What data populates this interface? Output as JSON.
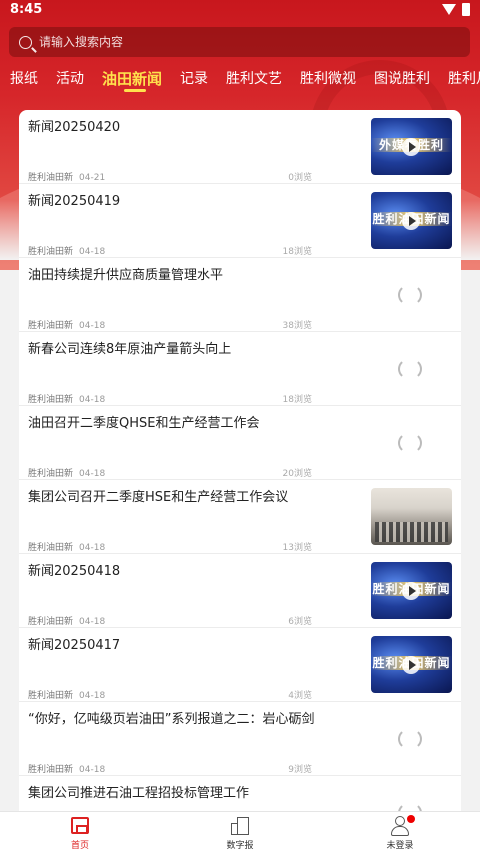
{
  "status_bar": {
    "time": "8:45"
  },
  "search": {
    "placeholder": "请输入搜索内容"
  },
  "tabs": [
    {
      "label": "报纸",
      "active": false
    },
    {
      "label": "活动",
      "active": false
    },
    {
      "label": "油田新闻",
      "active": true
    },
    {
      "label": "记录",
      "active": false
    },
    {
      "label": "胜利文艺",
      "active": false
    },
    {
      "label": "胜利微视",
      "active": false
    },
    {
      "label": "图说胜利",
      "active": false
    },
    {
      "label": "胜利月刊",
      "active": false
    }
  ],
  "articles": [
    {
      "title": "新闻20250420",
      "source": "胜利油田新",
      "date": "04-21",
      "views": "0浏览",
      "thumb": "video",
      "thumb_text": "外媒看胜利"
    },
    {
      "title": "新闻20250419",
      "source": "胜利油田新",
      "date": "04-18",
      "views": "18浏览",
      "thumb": "video",
      "thumb_text": "胜利油田新闻"
    },
    {
      "title": "油田持续提升供应商质量管理水平",
      "source": "胜利油田新",
      "date": "04-18",
      "views": "38浏览",
      "thumb": "loading"
    },
    {
      "title": "新春公司连续8年原油产量箭头向上",
      "source": "胜利油田新",
      "date": "04-18",
      "views": "18浏览",
      "thumb": "loading"
    },
    {
      "title": "油田召开二季度QHSE和生产经营工作会",
      "source": "胜利油田新",
      "date": "04-18",
      "views": "20浏览",
      "thumb": "loading"
    },
    {
      "title": "集团公司召开二季度HSE和生产经营工作会议",
      "source": "胜利油田新",
      "date": "04-18",
      "views": "13浏览",
      "thumb": "photo"
    },
    {
      "title": "新闻20250418",
      "source": "胜利油田新",
      "date": "04-18",
      "views": "6浏览",
      "thumb": "video",
      "thumb_text": "胜利油田新闻"
    },
    {
      "title": "新闻20250417",
      "source": "胜利油田新",
      "date": "04-18",
      "views": "4浏览",
      "thumb": "video",
      "thumb_text": "胜利油田新闻"
    },
    {
      "title": "“你好，亿吨级页岩油田”系列报道之二：岩心砺剑",
      "source": "胜利油田新",
      "date": "04-18",
      "views": "9浏览",
      "thumb": "loading"
    },
    {
      "title": "集团公司推进石油工程招投标管理工作",
      "source": "",
      "date": "",
      "views": "",
      "thumb": "loading"
    }
  ],
  "bottom_nav": [
    {
      "label": "首页",
      "icon": "home-icon",
      "active": true
    },
    {
      "label": "数字报",
      "icon": "newspaper-icon",
      "active": false
    },
    {
      "label": "未登录",
      "icon": "user-icon",
      "active": false
    }
  ],
  "colors": {
    "brand_red": "#d22",
    "tab_active": "#ffe14d"
  }
}
